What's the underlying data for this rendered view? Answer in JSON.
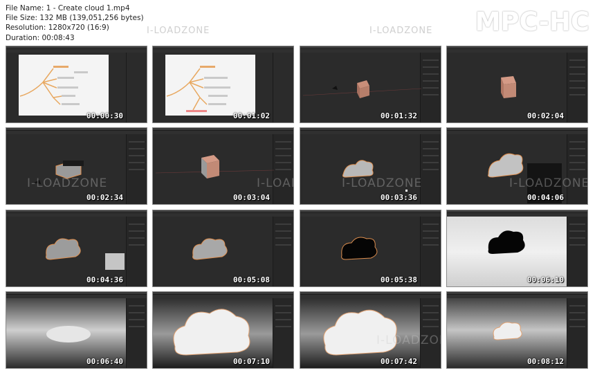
{
  "file_info": {
    "name_line": "File Name: 1 - Create cloud 1.mp4",
    "size_line": "File Size: 132 MB (139,051,256 bytes)",
    "resolution_line": "Resolution: 1280x720 (16:9)",
    "duration_line": "Duration: 00:08:43"
  },
  "brand": "MPC-HC",
  "watermark": "I-LOADZONE",
  "thumbnails": [
    {
      "time": "00:00:30"
    },
    {
      "time": "00:01:02"
    },
    {
      "time": "00:01:32"
    },
    {
      "time": "00:02:04"
    },
    {
      "time": "00:02:34"
    },
    {
      "time": "00:03:04"
    },
    {
      "time": "00:03:36"
    },
    {
      "time": "00:04:06"
    },
    {
      "time": "00:04:36"
    },
    {
      "time": "00:05:08"
    },
    {
      "time": "00:05:38"
    },
    {
      "time": "00:06:10"
    },
    {
      "time": "00:06:40"
    },
    {
      "time": "00:07:10"
    },
    {
      "time": "00:07:42"
    },
    {
      "time": "00:08:12"
    }
  ]
}
